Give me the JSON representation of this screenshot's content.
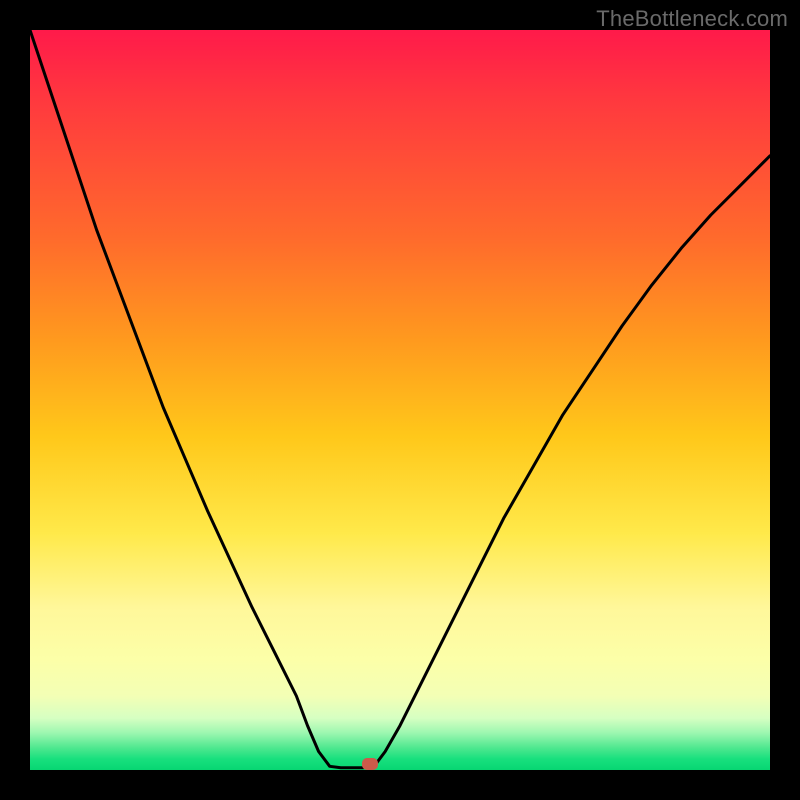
{
  "watermark": {
    "text": "TheBottleneck.com"
  },
  "chart_data": {
    "type": "line",
    "title": "",
    "xlabel": "",
    "ylabel": "",
    "xlim": [
      0,
      100
    ],
    "ylim": [
      0,
      100
    ],
    "grid": false,
    "series": [
      {
        "name": "left-branch",
        "x": [
          0,
          3,
          6,
          9,
          12,
          15,
          18,
          21,
          24,
          27,
          30,
          33,
          36,
          37.5,
          39,
          40.5
        ],
        "y": [
          100,
          91,
          82,
          73,
          65,
          57,
          49,
          42,
          35,
          28.5,
          22,
          16,
          10,
          6,
          2.5,
          0.5
        ]
      },
      {
        "name": "flat-bottom",
        "x": [
          40.5,
          42,
          43.5,
          45,
          46.5
        ],
        "y": [
          0.5,
          0.3,
          0.3,
          0.3,
          0.5
        ]
      },
      {
        "name": "right-branch",
        "x": [
          46.5,
          48,
          50,
          53,
          56,
          60,
          64,
          68,
          72,
          76,
          80,
          84,
          88,
          92,
          96,
          100
        ],
        "y": [
          0.5,
          2.5,
          6,
          12,
          18,
          26,
          34,
          41,
          48,
          54,
          60,
          65.5,
          70.5,
          75,
          79,
          83
        ]
      }
    ],
    "marker": {
      "name": "current-point",
      "x": 46,
      "y": 0.8,
      "color": "#cc5a4a"
    },
    "background_gradient": {
      "top": "#ff1a4a",
      "mid": "#ffe94a",
      "bottom": "#07d672"
    }
  }
}
